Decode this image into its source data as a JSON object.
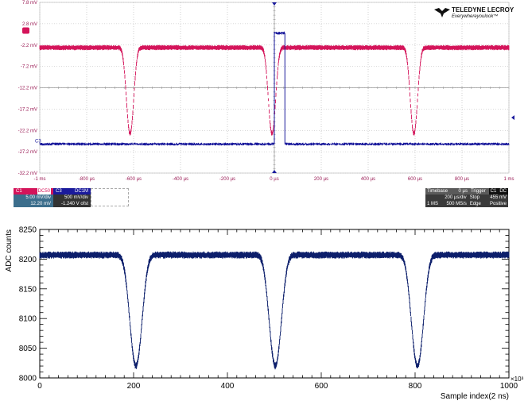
{
  "brand": {
    "name": "TELEDYNE LECROY",
    "tagline": "Everywhereyoulook™"
  },
  "colors": {
    "ch1": "#d4145a",
    "ch3": "#1a1a9c",
    "root_trace": "#0c1e6b",
    "scope_grid": "#9a9a9a"
  },
  "scope": {
    "ch3_marker": "C3",
    "channel_boxes": [
      {
        "tag": "C1",
        "mode": "DC50",
        "vdiv": "5.00 mV/div",
        "offset": "12.20 mV"
      },
      {
        "tag": "C3",
        "mode": "DC1M",
        "vdiv": "500 mV/div",
        "offset": "-1.240 V ofst"
      }
    ],
    "timebase": {
      "label": "Timebase",
      "delay": "0 µs",
      "tdiv": "200 µs/div",
      "points": "1 MS",
      "rate": "500 MS/s"
    },
    "trigger": {
      "label": "Trigger",
      "ch": "C1",
      "coupling": "DC",
      "mode": "Stop",
      "level": "455 mV",
      "type": "Edge",
      "slope": "Positive"
    }
  },
  "chart_data": [
    {
      "type": "line",
      "ylim": [
        -32.2,
        7.8
      ],
      "xlim": [
        -1000,
        1000
      ],
      "y_ticks": [
        "7.8 mV",
        "2.8 mV",
        "-2.2 mV",
        "-7.2 mV",
        "-12.2 mV",
        "-17.2 mV",
        "-22.2 mV",
        "-27.2 mV",
        "-32.2 mV"
      ],
      "x_ticks": [
        "-1 ms",
        "-800 µs",
        "-600 µs",
        "-400 µs",
        "-200 µs",
        "0 µs",
        "200 µs",
        "400 µs",
        "600 µs",
        "800 µs",
        "1 ms"
      ],
      "grid": true,
      "series": [
        {
          "name": "C1",
          "baseline": -2.8,
          "dips": [
            {
              "x": -615,
              "min": -23.0
            },
            {
              "x": -10,
              "min": -23.0
            },
            {
              "x": 595,
              "min": -23.0
            }
          ]
        },
        {
          "name": "C3",
          "baseline": -25.4,
          "pulse": {
            "start": 0,
            "end": 45,
            "level": 0.6
          }
        }
      ]
    },
    {
      "type": "line",
      "xlabel": "Sample index(2 ns)",
      "ylabel": "ADC counts",
      "x_multiplier": "×10³",
      "xlim": [
        0,
        1000
      ],
      "ylim": [
        8000,
        8250
      ],
      "x_ticks": [
        "0",
        "200",
        "400",
        "600",
        "800",
        "1000"
      ],
      "y_ticks": [
        "8000",
        "8050",
        "8100",
        "8150",
        "8200",
        "8250"
      ],
      "baseline": 8207,
      "dips": [
        {
          "x": 205,
          "min": 8020
        },
        {
          "x": 502,
          "min": 8020
        },
        {
          "x": 805,
          "min": 8020
        }
      ]
    }
  ]
}
